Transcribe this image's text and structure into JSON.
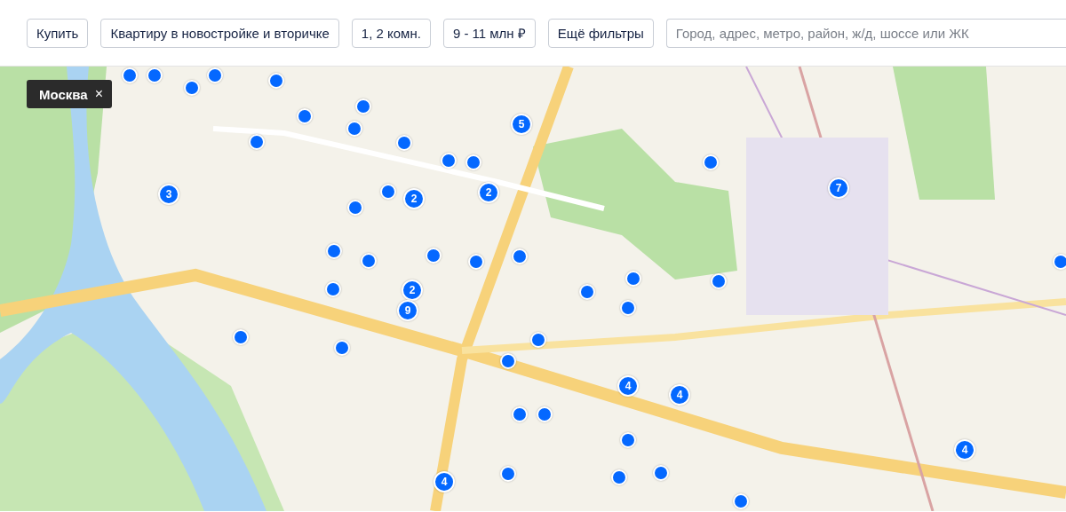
{
  "filters": [
    {
      "label": "Купить"
    },
    {
      "label": "Квартиру в новостройке и вторичке"
    },
    {
      "label": "1, 2 комн."
    },
    {
      "label": "9 - 11 млн ₽"
    },
    {
      "label": "Ещё фильтры"
    }
  ],
  "search": {
    "placeholder": "Город, адрес, метро, район, ж/д, шоссе или ЖК"
  },
  "location_tag": {
    "label": "Москва",
    "remove": "×"
  },
  "map_pins": [
    {
      "kind": "single"
    },
    {
      "kind": "single"
    },
    {
      "kind": "single"
    },
    {
      "kind": "single"
    },
    {
      "kind": "single"
    },
    {
      "kind": "single"
    },
    {
      "kind": "single"
    },
    {
      "kind": "single"
    },
    {
      "kind": "single"
    },
    {
      "kind": "single"
    },
    {
      "kind": "single"
    },
    {
      "kind": "single"
    },
    {
      "kind": "single"
    },
    {
      "kind": "single"
    },
    {
      "kind": "single"
    },
    {
      "kind": "single"
    },
    {
      "kind": "single"
    },
    {
      "kind": "single"
    },
    {
      "kind": "single"
    },
    {
      "kind": "single"
    },
    {
      "kind": "single"
    },
    {
      "kind": "single"
    },
    {
      "kind": "single"
    },
    {
      "kind": "single"
    },
    {
      "kind": "single"
    },
    {
      "kind": "single"
    },
    {
      "kind": "single"
    },
    {
      "kind": "single"
    },
    {
      "kind": "single"
    },
    {
      "kind": "single"
    },
    {
      "kind": "single"
    },
    {
      "kind": "single"
    },
    {
      "kind": "single"
    },
    {
      "kind": "single"
    },
    {
      "kind": "single"
    },
    {
      "kind": "single"
    },
    {
      "kind": "single"
    },
    {
      "kind": "cluster",
      "count": "5"
    },
    {
      "kind": "cluster",
      "count": "3"
    },
    {
      "kind": "cluster",
      "count": "2"
    },
    {
      "kind": "cluster",
      "count": "2"
    },
    {
      "kind": "cluster",
      "count": "7"
    },
    {
      "kind": "cluster",
      "count": "2"
    },
    {
      "kind": "cluster",
      "count": "9"
    },
    {
      "kind": "cluster",
      "count": "4"
    },
    {
      "kind": "cluster",
      "count": "4"
    },
    {
      "kind": "cluster",
      "count": "4"
    },
    {
      "kind": "cluster",
      "count": "4"
    }
  ]
}
